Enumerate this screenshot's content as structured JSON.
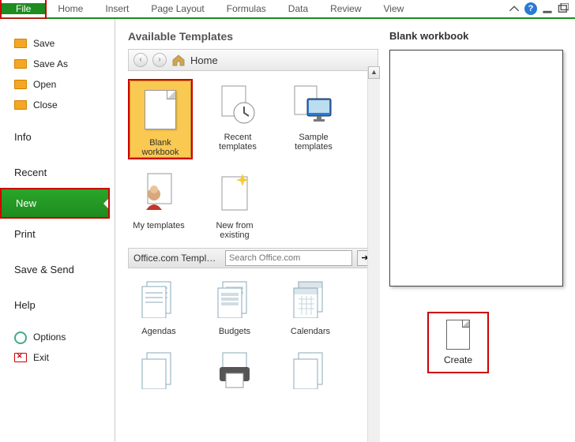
{
  "ribbon": {
    "tabs": [
      "File",
      "Home",
      "Insert",
      "Page Layout",
      "Formulas",
      "Data",
      "Review",
      "View"
    ]
  },
  "sidebar": {
    "save": "Save",
    "save_as": "Save As",
    "open": "Open",
    "close": "Close",
    "info": "Info",
    "recent": "Recent",
    "new": "New",
    "print": "Print",
    "save_send": "Save & Send",
    "help": "Help",
    "options": "Options",
    "exit": "Exit"
  },
  "center": {
    "heading": "Available Templates",
    "breadcrumb": "Home",
    "templates": {
      "blank": "Blank workbook",
      "recent": "Recent templates",
      "sample": "Sample templates",
      "my": "My templates",
      "new_existing": "New from existing"
    },
    "office_section": "Office.com Templ…",
    "search_placeholder": "Search Office.com",
    "office_items": {
      "agendas": "Agendas",
      "budgets": "Budgets",
      "calendars": "Calendars"
    }
  },
  "right": {
    "title": "Blank workbook",
    "create": "Create"
  }
}
